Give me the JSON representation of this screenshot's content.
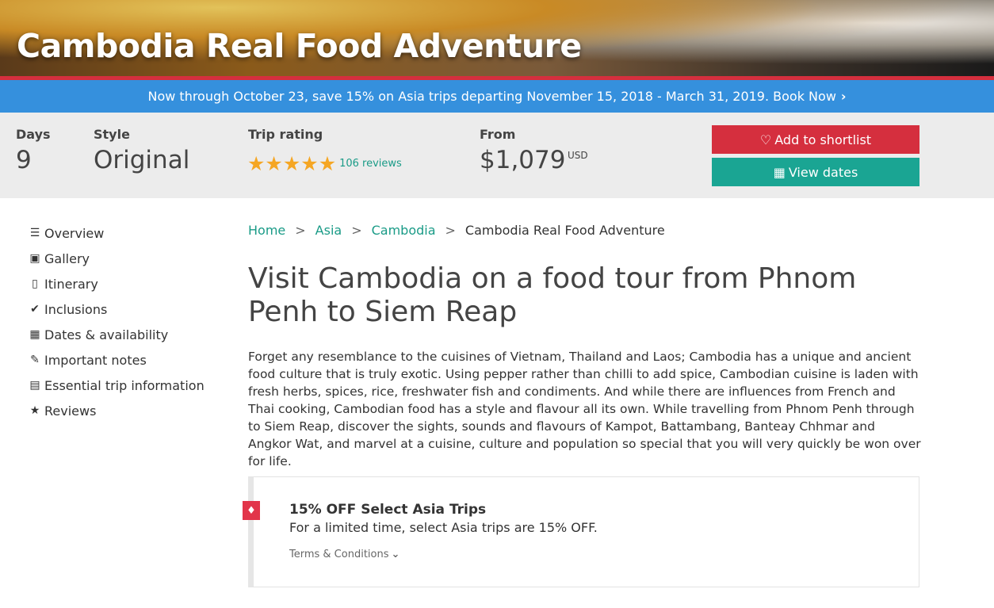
{
  "hero": {
    "title": "Cambodia Real Food Adventure"
  },
  "promo": {
    "text": "Now through October 23, save 15% on Asia trips departing November 15, 2018 - March 31, 2019. Book Now",
    "chevron": "›"
  },
  "info": {
    "days_label": "Days",
    "days_value": "9",
    "style_label": "Style",
    "style_value": "Original",
    "rating_label": "Trip rating",
    "rating_stars": 5,
    "reviews": "106 reviews",
    "from_label": "From",
    "price": "$1,079",
    "currency": "USD"
  },
  "buttons": {
    "shortlist": "Add to shortlist",
    "shortlist_icon": "heart-icon",
    "dates": "View dates",
    "dates_icon": "calendar-icon"
  },
  "sidebar": {
    "items": [
      {
        "label": "Overview",
        "icon": "list-icon"
      },
      {
        "label": "Gallery",
        "icon": "image-icon"
      },
      {
        "label": "Itinerary",
        "icon": "map-icon"
      },
      {
        "label": "Inclusions",
        "icon": "check-icon"
      },
      {
        "label": "Dates & availability",
        "icon": "calendar-icon"
      },
      {
        "label": "Important notes",
        "icon": "edit-icon"
      },
      {
        "label": "Essential trip information",
        "icon": "document-icon"
      },
      {
        "label": "Reviews",
        "icon": "star-icon"
      }
    ]
  },
  "breadcrumb": {
    "home": "Home",
    "region": "Asia",
    "country": "Cambodia",
    "current": "Cambodia Real Food Adventure",
    "separator": ">"
  },
  "headline": "Visit Cambodia on a food tour from Phnom Penh to Siem Reap",
  "description": "Forget any resemblance to the cuisines of Vietnam, Thailand and Laos; Cambodia has a unique and ancient food culture that is truly exotic. Using pepper rather than chilli to add spice, Cambodian cuisine is laden with fresh herbs, spices, rice, freshwater fish and condiments. And while there are influences from French and Thai cooking, Cambodian food has a style and flavour all its own. While travelling from Phnom Penh through to Siem Reap, discover the sights, sounds and flavours of Kampot, Battambang, Banteay Chhmar and Angkor Wat, and marvel at a cuisine, culture and population so special that you will very quickly be won over for life.",
  "offer": {
    "title": "15% OFF Select Asia Trips",
    "text": "For a limited time, select Asia trips are 15% OFF.",
    "terms": "Terms & Conditions"
  },
  "colors": {
    "brand_red": "#d52f3e",
    "promo_blue": "#3590dd",
    "teal": "#1aa593",
    "link": "#1a9b87",
    "star": "#f5a623"
  }
}
